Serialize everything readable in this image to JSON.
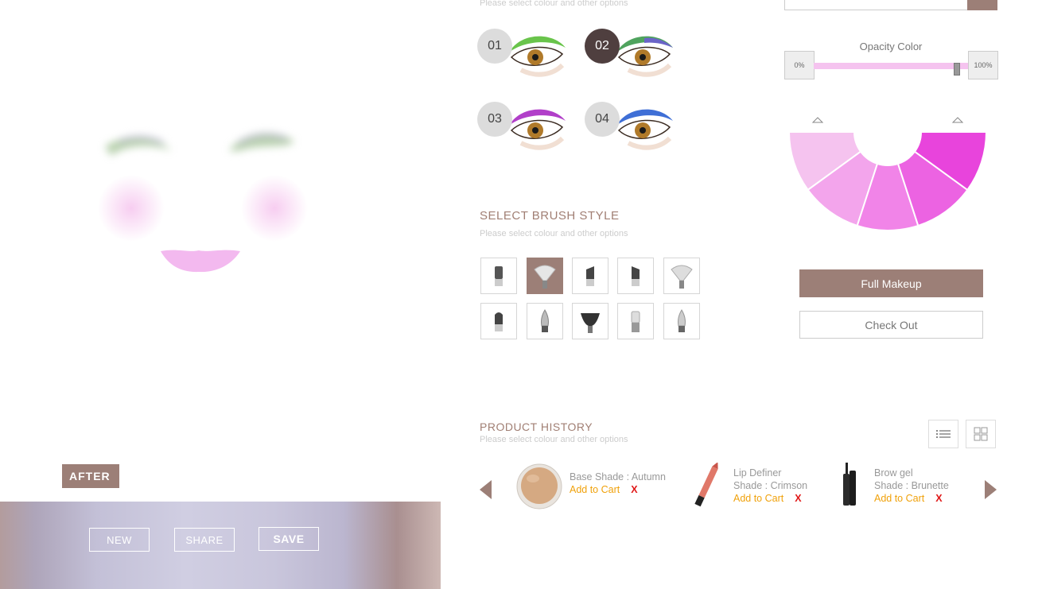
{
  "preview": {
    "after_label": "AFTER",
    "new_label": "NEW",
    "share_label": "SHARE",
    "save_label": "SAVE"
  },
  "eyeshadow": {
    "hint": "Please select colour and other options",
    "options": [
      {
        "num": "01",
        "color": "#69c44b",
        "selected": false
      },
      {
        "num": "02",
        "color": "#4fa35e",
        "selected": true
      },
      {
        "num": "03",
        "color": "#b13fc9",
        "selected": false
      },
      {
        "num": "04",
        "color": "#3f6fd6",
        "selected": false
      }
    ]
  },
  "brush": {
    "title": "SELECT BRUSH STYLE",
    "hint": "Please select colour and other options",
    "selected_index": 1
  },
  "history": {
    "title": "PRODUCT HISTORY",
    "hint": "Please select colour and other options",
    "items": [
      {
        "line1": "Base Shade : Autumn",
        "line2": "",
        "add": "Add to Cart",
        "remove": "X"
      },
      {
        "line1": "Lip Definer",
        "line2": "Shade : Crimson",
        "add": "Add to Cart",
        "remove": "X"
      },
      {
        "line1": "Brow gel",
        "line2": "Shade : Brunette",
        "add": "Add to Cart",
        "remove": "X"
      }
    ]
  },
  "opacity": {
    "label": "Opacity Color",
    "min_label": "0%",
    "max_label": "100%",
    "value_percent": 93
  },
  "palette": {
    "colors": [
      "#f5c3ef",
      "#f3a5ec",
      "#f184e8",
      "#ec63e2",
      "#e844dc"
    ]
  },
  "actions": {
    "full_makeup": "Full Makeup",
    "check_out": "Check Out"
  },
  "colors": {
    "accent": "#9c7f77",
    "add_to_cart": "#f0a10a",
    "remove": "#e01818"
  }
}
